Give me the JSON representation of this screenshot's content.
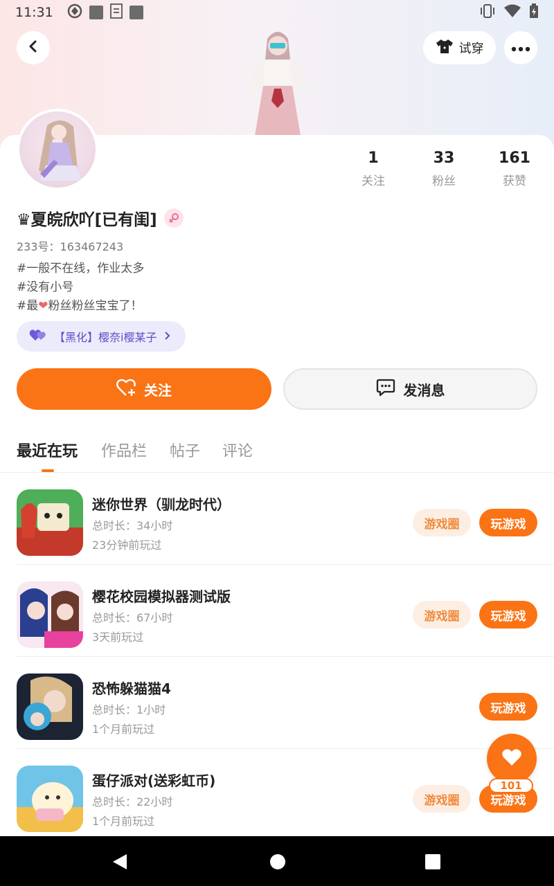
{
  "status_bar": {
    "time": "11:31"
  },
  "header": {
    "tryon_label": "试穿"
  },
  "profile": {
    "stats": [
      {
        "value": "1",
        "label": "关注"
      },
      {
        "value": "33",
        "label": "粉丝"
      },
      {
        "value": "161",
        "label": "获赞"
      }
    ],
    "username": "♛夏皖欣吖[已有闺]",
    "uid": "233号：163467243",
    "bio": {
      "line1": "#一般不在线，作业太多",
      "line2": "#没有小号",
      "line3_prefix": "#最",
      "line3_suffix": "粉丝粉丝宝宝了！"
    },
    "relation_label": "【黑化】樱奈i樱某子"
  },
  "actions": {
    "follow_label": "关注",
    "message_label": "发消息"
  },
  "tabs": [
    "最近在玩",
    "作品栏",
    "帖子",
    "评论"
  ],
  "games": [
    {
      "title": "迷你世界（驯龙时代）",
      "duration": "总时长：34小时",
      "last_played": "23分钟前玩过",
      "circle_label": "游戏圈",
      "play_label": "玩游戏"
    },
    {
      "title": "樱花校园模拟器测试版",
      "duration": "总时长：67小时",
      "last_played": "3天前玩过",
      "circle_label": "游戏圈",
      "play_label": "玩游戏"
    },
    {
      "title": "恐怖躲猫猫4",
      "duration": "总时长：1小时",
      "last_played": "1个月前玩过",
      "play_label": "玩游戏"
    },
    {
      "title": "蛋仔派对(送彩虹币)",
      "duration": "总时长：22小时",
      "last_played": "1个月前玩过",
      "circle_label": "游戏圈",
      "play_label": "玩游戏"
    }
  ],
  "fab": {
    "count": "101"
  },
  "colors": {
    "accent": "#fa7315",
    "chip_bg": "#fdeee3",
    "relation_bg": "#ecebfb"
  }
}
